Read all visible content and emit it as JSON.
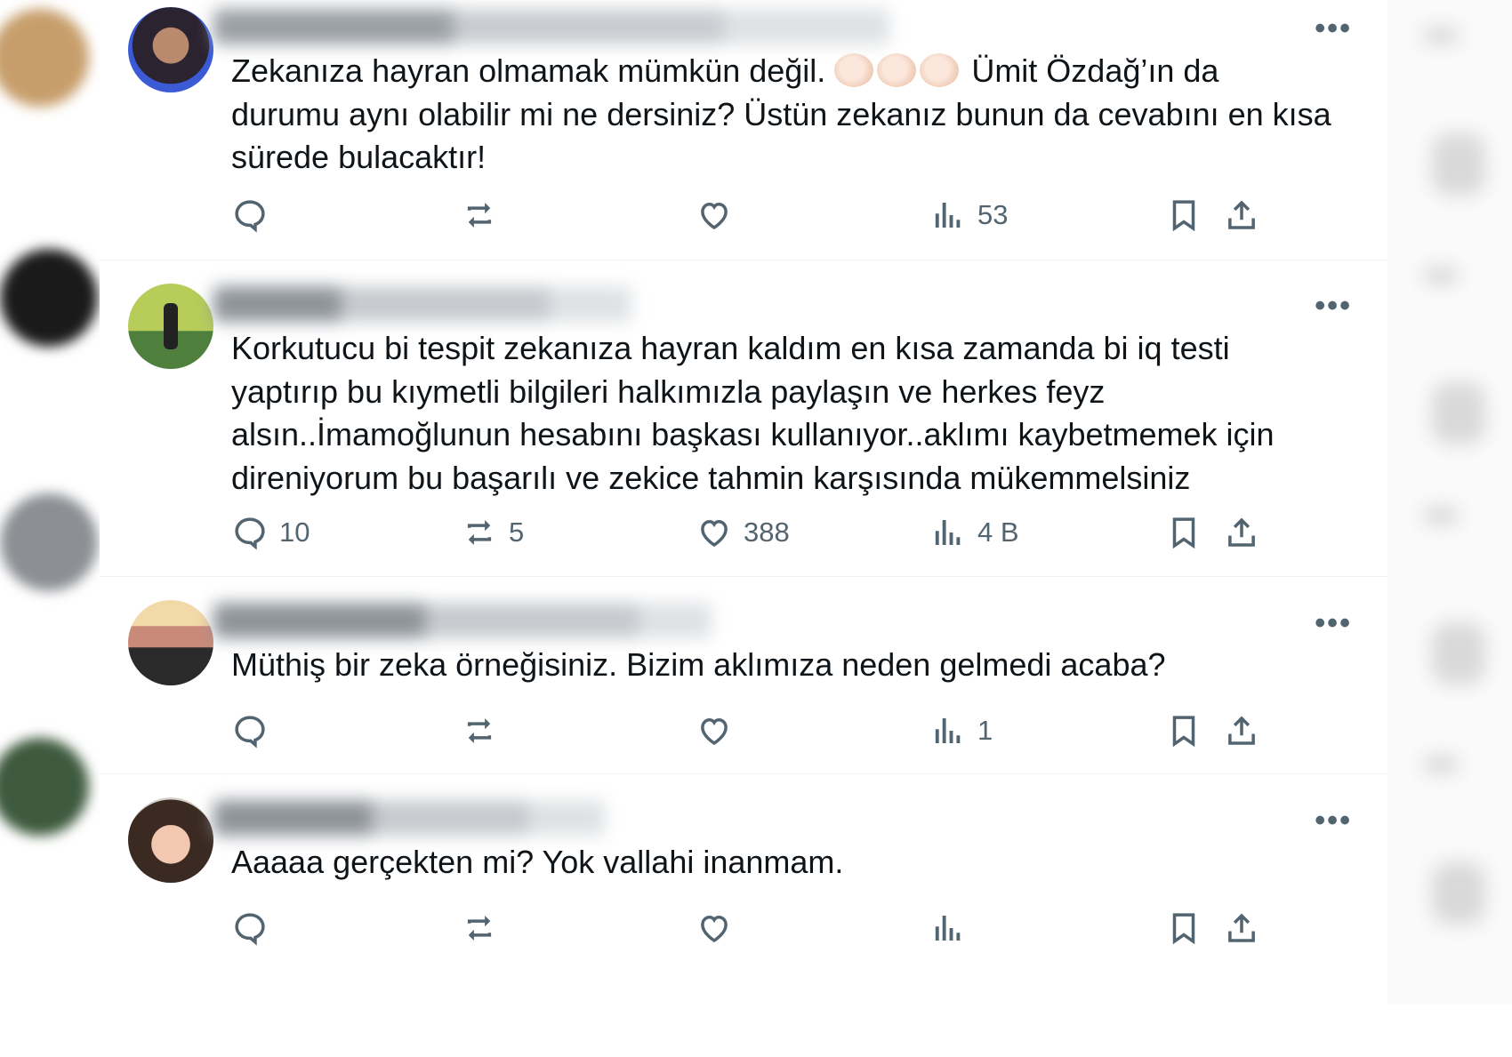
{
  "tweets": [
    {
      "text_parts": [
        "Zekanıza hayran olmamak mümkün değil. ",
        " Ümit Özdağ’ın da durumu aynı olabilir mi ne dersiniz? Üstün zekanız bunun da cevabını en kısa sürede bulacaktır!"
      ],
      "emoji": "clapping-hands",
      "replies": "",
      "retweets": "",
      "likes": "",
      "views": "53"
    },
    {
      "text": "Korkutucu bi tespit zekanıza hayran kaldım en kısa zamanda bi iq testi yaptırıp bu kıymetli bilgileri halkımızla paylaşın ve herkes feyz alsın..İmamoğlunun hesabını başkası kullanıyor..aklımı kaybetmemek için direniyorum bu başarılı ve zekice tahmin karşısında mükemmelsiniz",
      "replies": "10",
      "retweets": "5",
      "likes": "388",
      "views": "4 B"
    },
    {
      "text": "Müthiş bir zeka örneğisiniz. Bizim aklımıza neden gelmedi acaba?",
      "replies": "",
      "retweets": "",
      "likes": "",
      "views": "1"
    },
    {
      "text": "Aaaaa gerçekten mi? Yok vallahi inanmam.",
      "replies": "",
      "retweets": "",
      "likes": "",
      "views": ""
    }
  ],
  "more_glyph": "•••",
  "icons": {
    "reply": "reply-icon",
    "retweet": "retweet-icon",
    "like": "heart-icon",
    "views": "views-chart-icon",
    "bookmark": "bookmark-icon",
    "share": "share-icon"
  },
  "colors": {
    "text": "#0f1419",
    "muted": "#536471",
    "divider": "#eff3f4"
  }
}
